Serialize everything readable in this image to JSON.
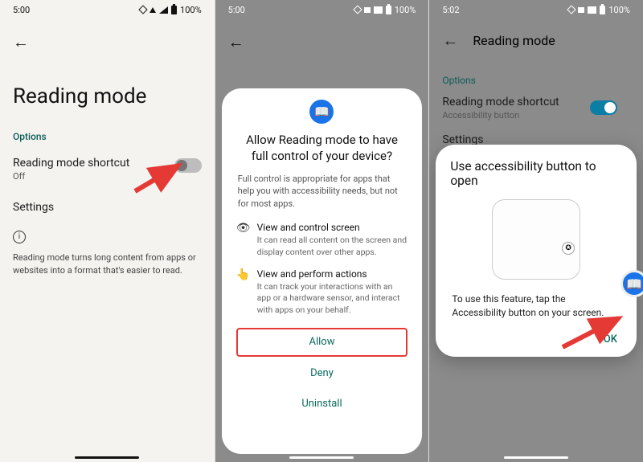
{
  "screens": {
    "s1": {
      "time": "5:00",
      "battery": "100%",
      "title": "Reading mode",
      "options_label": "Options",
      "shortcut": {
        "label": "Reading mode shortcut",
        "state": "Off"
      },
      "settings_label": "Settings",
      "footer": "Reading mode turns long content from apps or websites into a format that's easier to read."
    },
    "s2": {
      "time": "5:00",
      "battery": "100%",
      "dialog": {
        "title": "Allow Reading mode to have full control of your device?",
        "subtitle": "Full control is appropriate for apps that help you with accessibility needs, but not for most apps.",
        "perm1": {
          "title": "View and control screen",
          "desc": "It can read all content on the screen and display content over other apps."
        },
        "perm2": {
          "title": "View and perform actions",
          "desc": "It can track your interactions with an app or a hardware sensor, and interact with apps on your behalf."
        },
        "allow": "Allow",
        "deny": "Deny",
        "uninstall": "Uninstall"
      }
    },
    "s3": {
      "time": "5:02",
      "battery": "100%",
      "title": "Reading mode",
      "options_label": "Options",
      "shortcut": {
        "label": "Reading mode shortcut",
        "state": "Accessibility button"
      },
      "settings_label": "Settings",
      "dialog": {
        "title": "Use accessibility button to open",
        "desc": "To use this feature, tap the Accessibility button on your screen.",
        "ok": "OK"
      }
    }
  },
  "annotations": {
    "arrow_color": "#e53935",
    "highlight_color": "#e53935"
  }
}
